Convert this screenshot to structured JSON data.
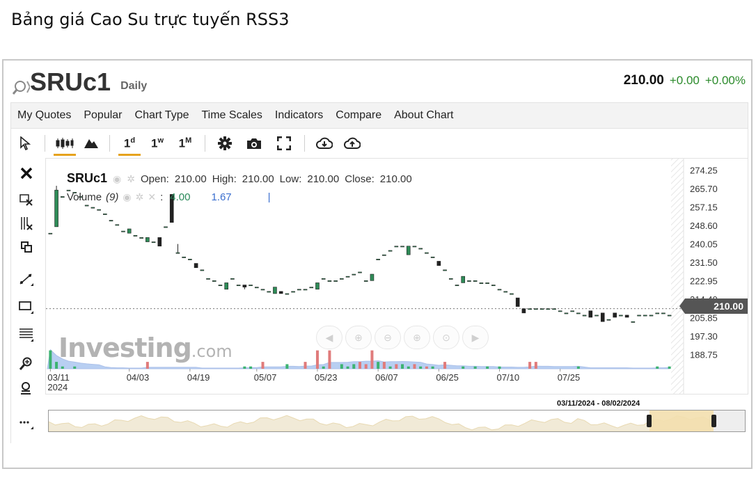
{
  "page": {
    "title": "Bảng giá Cao Su trực tuyến RSS3"
  },
  "header": {
    "symbol": "SRUc1",
    "period": "Daily",
    "last": "210.00",
    "change": "+0.00",
    "change_pct": "+0.00%"
  },
  "menu": [
    "My Quotes",
    "Popular",
    "Chart Type",
    "Time Scales",
    "Indicators",
    "Compare",
    "About Chart"
  ],
  "toolbar": {
    "d": "1",
    "d_sup": "d",
    "w": "1",
    "w_sup": "w",
    "m": "1",
    "m_sup": "M"
  },
  "legend": {
    "symbol": "SRUc1",
    "open_label": "Open:",
    "open": "210.00",
    "high_label": "High:",
    "high": "210.00",
    "low_label": "Low:",
    "low": "210.00",
    "close_label": "Close:",
    "close": "210.00",
    "volume_label": "Volume",
    "volume_period": "(9)",
    "volume_value1": "4.00",
    "volume_value2": "1.67",
    "volume_sep": "|"
  },
  "watermark": {
    "brand": "Investing",
    "suffix": ".com"
  },
  "price_tag": "210.00",
  "navigator": {
    "range_label": "03/11/2024 - 08/02/2024"
  },
  "colors": {
    "accent": "#e6a21d",
    "up": "#2a8a2a",
    "candle_up": "#2e8b57",
    "candle_down": "#222222",
    "volume_up": "#3cb371",
    "volume_down": "#e07b7b",
    "volume_area": "#7fa8e8",
    "navigator_fill": "#f3dfae"
  },
  "chart_data": {
    "type": "candlestick",
    "title": "SRUc1",
    "y_ticks": [
      "274.25",
      "265.70",
      "257.15",
      "248.60",
      "240.05",
      "231.50",
      "222.95",
      "214.40",
      "205.85",
      "197.30",
      "188.75"
    ],
    "x_ticks": [
      "03/11",
      "04/03",
      "04/19",
      "05/07",
      "05/23",
      "06/07",
      "06/25",
      "07/10",
      "07/25"
    ],
    "x_year": "2024",
    "ylim": [
      186,
      277
    ],
    "last_price": 210.0,
    "ohlc": [
      [
        0,
        245,
        245,
        245,
        245
      ],
      [
        1,
        248,
        267,
        248,
        265
      ],
      [
        2,
        262,
        262,
        262,
        262
      ],
      [
        3,
        265,
        265,
        265,
        265
      ],
      [
        4,
        264,
        264,
        264,
        264
      ],
      [
        5,
        262,
        262,
        262,
        262
      ],
      [
        6,
        258,
        258,
        258,
        258
      ],
      [
        7,
        257,
        257,
        257,
        257
      ],
      [
        8,
        256,
        256,
        256,
        256
      ],
      [
        9,
        254,
        254,
        254,
        254
      ],
      [
        10,
        251,
        251,
        251,
        251
      ],
      [
        11,
        249,
        249,
        249,
        249
      ],
      [
        12,
        246,
        246,
        246,
        246
      ],
      [
        13,
        245,
        247,
        245,
        247
      ],
      [
        14,
        244,
        244,
        244,
        244
      ],
      [
        15,
        243,
        243,
        243,
        243
      ],
      [
        16,
        241,
        243,
        241,
        243
      ],
      [
        17,
        241,
        241,
        241,
        241
      ],
      [
        18,
        243,
        243,
        239,
        239
      ],
      [
        19,
        248,
        248,
        248,
        248
      ],
      [
        20,
        263,
        263,
        250,
        250
      ],
      [
        21,
        236,
        240,
        236,
        236
      ],
      [
        22,
        234,
        234,
        234,
        234
      ],
      [
        23,
        233,
        233,
        233,
        233
      ],
      [
        24,
        231,
        231,
        229,
        229
      ],
      [
        25,
        228,
        228,
        228,
        228
      ],
      [
        26,
        224,
        224,
        224,
        224
      ],
      [
        27,
        223,
        223,
        223,
        223
      ],
      [
        28,
        221,
        221,
        221,
        221
      ],
      [
        29,
        219,
        222,
        219,
        222
      ],
      [
        30,
        224,
        224,
        224,
        224
      ],
      [
        31,
        221,
        221,
        221,
        221
      ],
      [
        32,
        221,
        221,
        219,
        220
      ],
      [
        33,
        221,
        221,
        221,
        221
      ],
      [
        34,
        220,
        220,
        220,
        220
      ],
      [
        35,
        219,
        219,
        219,
        219
      ],
      [
        36,
        218,
        218,
        218,
        218
      ],
      [
        37,
        217,
        220,
        217,
        220
      ],
      [
        38,
        218,
        218,
        217,
        217
      ],
      [
        39,
        217,
        217,
        217,
        217
      ],
      [
        40,
        218,
        218,
        218,
        218
      ],
      [
        41,
        219,
        219,
        219,
        219
      ],
      [
        42,
        219,
        219,
        219,
        219
      ],
      [
        43,
        220,
        220,
        220,
        220
      ],
      [
        44,
        219,
        222,
        219,
        222
      ],
      [
        45,
        224,
        224,
        224,
        224
      ],
      [
        46,
        223,
        223,
        223,
        223
      ],
      [
        47,
        223,
        223,
        223,
        223
      ],
      [
        48,
        224,
        224,
        224,
        224
      ],
      [
        49,
        225,
        225,
        225,
        225
      ],
      [
        50,
        226,
        226,
        226,
        226
      ],
      [
        51,
        227,
        227,
        227,
        227
      ],
      [
        52,
        223,
        223,
        223,
        223
      ],
      [
        53,
        223,
        226,
        223,
        226
      ],
      [
        54,
        233,
        233,
        233,
        233
      ],
      [
        55,
        235,
        235,
        235,
        235
      ],
      [
        56,
        237,
        237,
        237,
        237
      ],
      [
        57,
        239,
        239,
        239,
        239
      ],
      [
        58,
        239,
        239,
        239,
        239
      ],
      [
        59,
        235,
        239,
        235,
        239
      ],
      [
        60,
        239,
        239,
        239,
        239
      ],
      [
        61,
        238,
        238,
        238,
        238
      ],
      [
        62,
        236,
        236,
        236,
        236
      ],
      [
        63,
        234,
        234,
        234,
        234
      ],
      [
        64,
        232,
        232,
        230,
        230
      ],
      [
        65,
        228,
        228,
        228,
        228
      ],
      [
        66,
        224,
        224,
        224,
        224
      ],
      [
        67,
        221,
        221,
        221,
        221
      ],
      [
        68,
        222,
        225,
        222,
        225
      ],
      [
        69,
        223,
        223,
        223,
        223
      ],
      [
        70,
        223,
        223,
        223,
        223
      ],
      [
        71,
        222,
        222,
        222,
        222
      ],
      [
        72,
        222,
        222,
        222,
        222
      ],
      [
        73,
        221,
        221,
        221,
        221
      ],
      [
        74,
        219,
        219,
        219,
        219
      ],
      [
        75,
        218,
        218,
        218,
        218
      ],
      [
        76,
        217,
        217,
        217,
        217
      ],
      [
        77,
        215,
        215,
        211,
        211
      ],
      [
        78,
        210,
        210,
        208,
        208
      ],
      [
        79,
        210,
        210,
        210,
        210
      ],
      [
        80,
        210,
        210,
        210,
        210
      ],
      [
        81,
        210,
        210,
        210,
        210
      ],
      [
        82,
        210,
        210,
        210,
        210
      ],
      [
        83,
        210,
        210,
        210,
        210
      ],
      [
        84,
        209,
        209,
        209,
        209
      ],
      [
        85,
        208,
        208,
        208,
        208
      ],
      [
        86,
        209,
        209,
        209,
        209
      ],
      [
        87,
        208,
        208,
        208,
        208
      ],
      [
        88,
        207,
        207,
        207,
        207
      ],
      [
        89,
        209,
        209,
        206,
        206
      ],
      [
        90,
        207,
        207,
        207,
        207
      ],
      [
        91,
        208,
        208,
        204,
        204
      ],
      [
        92,
        205,
        205,
        205,
        205
      ],
      [
        93,
        208,
        208,
        206,
        206
      ],
      [
        94,
        207,
        207,
        207,
        207
      ],
      [
        95,
        207,
        207,
        206,
        206
      ],
      [
        96,
        204,
        204,
        204,
        204
      ],
      [
        97,
        207,
        207,
        207,
        207
      ],
      [
        98,
        207,
        207,
        207,
        207
      ],
      [
        99,
        207,
        207,
        207,
        207
      ],
      [
        100,
        208,
        208,
        208,
        208
      ],
      [
        101,
        208,
        208,
        208,
        208
      ],
      [
        102,
        207,
        207,
        207,
        207
      ]
    ],
    "volume": [
      [
        0,
        8,
        0
      ],
      [
        1,
        3,
        0
      ],
      [
        2,
        1,
        0
      ],
      [
        3,
        0,
        0
      ],
      [
        4,
        1,
        0
      ],
      [
        5,
        0,
        0
      ],
      [
        6,
        0,
        0
      ],
      [
        7,
        0,
        0
      ],
      [
        8,
        0,
        0
      ],
      [
        9,
        0,
        0
      ],
      [
        10,
        0,
        0
      ],
      [
        11,
        0,
        0
      ],
      [
        12,
        0,
        0
      ],
      [
        13,
        0,
        0
      ],
      [
        14,
        0,
        0
      ],
      [
        15,
        0,
        0
      ],
      [
        16,
        3,
        1
      ],
      [
        17,
        0,
        0
      ],
      [
        18,
        0,
        0
      ],
      [
        19,
        0,
        0
      ],
      [
        20,
        0,
        0
      ],
      [
        21,
        0,
        0
      ],
      [
        22,
        0,
        0
      ],
      [
        23,
        0,
        0
      ],
      [
        24,
        0,
        0
      ],
      [
        25,
        0,
        0
      ],
      [
        26,
        0,
        0
      ],
      [
        27,
        0,
        0
      ],
      [
        28,
        0,
        0
      ],
      [
        29,
        0,
        0
      ],
      [
        30,
        0,
        0
      ],
      [
        31,
        0,
        0
      ],
      [
        32,
        1,
        0
      ],
      [
        33,
        1,
        0
      ],
      [
        34,
        0,
        0
      ],
      [
        35,
        3,
        1
      ],
      [
        36,
        0,
        0
      ],
      [
        37,
        0,
        0
      ],
      [
        38,
        0,
        0
      ],
      [
        39,
        2,
        0
      ],
      [
        40,
        0,
        0
      ],
      [
        41,
        0,
        0
      ],
      [
        42,
        3,
        1
      ],
      [
        43,
        0,
        0
      ],
      [
        44,
        8,
        1
      ],
      [
        45,
        1,
        0
      ],
      [
        46,
        8,
        1
      ],
      [
        47,
        0,
        0
      ],
      [
        48,
        2,
        0
      ],
      [
        49,
        1,
        0
      ],
      [
        50,
        2,
        0
      ],
      [
        51,
        3,
        1
      ],
      [
        52,
        2,
        1
      ],
      [
        53,
        8,
        1
      ],
      [
        54,
        3,
        0
      ],
      [
        55,
        3,
        1
      ],
      [
        56,
        1,
        0
      ],
      [
        57,
        2,
        1
      ],
      [
        58,
        2,
        0
      ],
      [
        59,
        1,
        0
      ],
      [
        60,
        2,
        1
      ],
      [
        61,
        1,
        0
      ],
      [
        62,
        1,
        1
      ],
      [
        63,
        1,
        0
      ],
      [
        64,
        0,
        0
      ],
      [
        65,
        3,
        1
      ],
      [
        66,
        0,
        0
      ],
      [
        67,
        0,
        0
      ],
      [
        68,
        1,
        0
      ],
      [
        69,
        0,
        0
      ],
      [
        70,
        1,
        0
      ],
      [
        71,
        0,
        0
      ],
      [
        72,
        1,
        0
      ],
      [
        73,
        0,
        0
      ],
      [
        74,
        1,
        0
      ],
      [
        75,
        0,
        0
      ],
      [
        76,
        0,
        0
      ],
      [
        77,
        0,
        0
      ],
      [
        78,
        0,
        0
      ],
      [
        79,
        3,
        1
      ],
      [
        80,
        3,
        1
      ],
      [
        81,
        0,
        0
      ],
      [
        82,
        0,
        0
      ],
      [
        83,
        0,
        0
      ],
      [
        84,
        0,
        0
      ],
      [
        85,
        0,
        0
      ],
      [
        86,
        0,
        0
      ],
      [
        87,
        1,
        0
      ],
      [
        88,
        0,
        0
      ],
      [
        89,
        0,
        0
      ],
      [
        90,
        0,
        0
      ],
      [
        91,
        0,
        0
      ],
      [
        92,
        0,
        0
      ],
      [
        93,
        0,
        0
      ],
      [
        94,
        0,
        0
      ],
      [
        95,
        0,
        0
      ],
      [
        96,
        0,
        0
      ],
      [
        97,
        0,
        0
      ],
      [
        98,
        0,
        0
      ],
      [
        99,
        0,
        0
      ],
      [
        100,
        1,
        0
      ],
      [
        101,
        0,
        0
      ],
      [
        102,
        1,
        0
      ]
    ]
  }
}
